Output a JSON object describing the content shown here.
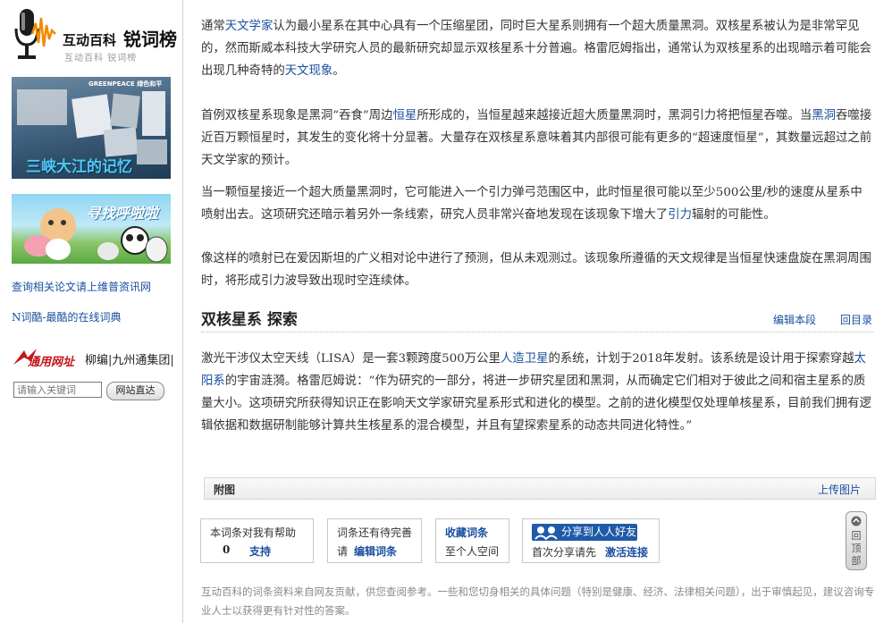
{
  "sidebar": {
    "logo": {
      "brand": "互动百科",
      "title": "锐词榜",
      "sub": "互动百科 锐词榜"
    },
    "banner1": {
      "org": "GREENPEACE 绿色和平",
      "caption": "三峡大江的记忆"
    },
    "banner2": {
      "caption": "寻找呼啦啦"
    },
    "links": [
      "查询相关论文请上维普资讯网",
      "N词酷-最酷的在线词典"
    ],
    "tongyong": {
      "label": "通用网址",
      "text": "柳编|九州通集团|"
    },
    "search": {
      "placeholder": "请输入关键词",
      "button": "网站直达"
    }
  },
  "article": {
    "para1": [
      {
        "t": "通常"
      },
      {
        "t": "天文学家",
        "link": true
      },
      {
        "t": "认为最小星系在其中心具有一个压缩星团，同时巨大星系则拥有一个超大质量黑洞。双核星系被认为是非常罕见的，然而斯威本科技大学研究人员的最新研究却显示双核星系十分普遍。格雷厄姆指出，通常认为双核星系的出现暗示着可能会出现几种奇特的"
      },
      {
        "t": "天文现象",
        "link": true
      },
      {
        "t": "。"
      }
    ],
    "para2": [
      {
        "t": "首例双核星系现象是黑洞“吞食”周边"
      },
      {
        "t": "恒星",
        "link": true
      },
      {
        "t": "所形成的，当恒星越来越接近超大质量黑洞时，黑洞引力将把恒星吞噬。当"
      },
      {
        "t": "黑洞",
        "link": true
      },
      {
        "t": "吞噬接近百万颗恒星时，其发生的变化将十分显著。大量存在双核星系意味着其内部很可能有更多的“超速度恒星”，其数量远超过之前天文学家的预计。"
      }
    ],
    "para3": [
      {
        "t": "当一颗恒星接近一个超大质量黑洞时，它可能进入一个引力弹弓范围区中，此时恒星很可能以至少500公里/秒的速度从星系中喷射出去。这项研究还暗示着另外一条线索，研究人员非常兴奋地发现在该现象下增大了"
      },
      {
        "t": "引力",
        "link": true
      },
      {
        "t": "辐射的可能性。"
      }
    ],
    "para4": [
      {
        "t": "像这样的喷射已在爱因斯坦的广义相对论中进行了预测，但从未观测过。该现象所遵循的天文规律是当恒星快速盘旋在黑洞周围时，将形成引力波导致出现时空连续体。"
      }
    ],
    "section": {
      "title": "双核星系 探索",
      "edit": "编辑本段",
      "back": "回目录"
    },
    "para5": [
      {
        "t": "激光干涉仪太空天线（LISA）是一套3颗跨度500万公里"
      },
      {
        "t": "人造卫星",
        "link": true
      },
      {
        "t": "的系统，计划于2018年发射。该系统是设计用于探索穿越"
      },
      {
        "t": "太阳系",
        "link": true
      },
      {
        "t": "的宇宙涟漪。格雷厄姆说：“作为研究的一部分，将进一步研究星团和黑洞，从而确定它们相对于彼此之间和宿主星系的质量大小。这项研究所获得知识正在影响天文学家研究星系形式和进化的模型。之前的进化模型仅处理单核星系，目前我们拥有逻辑依据和数据研制能够计算共生核星系的混合模型，并且有望探索星系的动态共同进化特性。”"
      }
    ]
  },
  "attach": {
    "label": "附图",
    "upload": "上传图片"
  },
  "boxes": {
    "helpful": {
      "text": "本词条对我有帮助",
      "count": "0",
      "support": "支持"
    },
    "improve": {
      "text": "词条还有待完善",
      "please": "请",
      "edit": "编辑词条"
    },
    "collect": {
      "title": "收藏词条",
      "sub": "至个人空间"
    },
    "share": {
      "button": "分享到人人好友",
      "first": "首次分享请先",
      "activate": "激活连接"
    }
  },
  "footnote": "互动百科的词条资料来自网友贡献，供您查阅参考。一些和您切身相关的具体问题（特别是健康、经济、法律相关问题），出于审慎起见，建议咨询专业人士以获得更有针对性的答案。",
  "totop": "回顶部"
}
